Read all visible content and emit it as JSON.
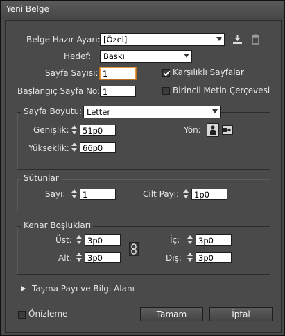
{
  "window": {
    "title": "Yeni Belge"
  },
  "preset": {
    "label": "Belge Hazır Ayarı:",
    "value": "[Özel]"
  },
  "intent": {
    "label": "Hedef:",
    "value": "Baskı"
  },
  "pages": {
    "label": "Sayfa Sayısı:",
    "value": "1"
  },
  "start_page": {
    "label": "Başlangıç Sayfa No:",
    "value": "1"
  },
  "facing_pages": {
    "label": "Karşılıklı Sayfalar",
    "checked": true
  },
  "primary_text_frame": {
    "label": "Birincil Metin Çerçevesi",
    "checked": false
  },
  "page_size": {
    "label": "Sayfa Boyutu:",
    "value": "Letter",
    "width_label": "Genişlik:",
    "width": "51p0",
    "height_label": "Yükseklik:",
    "height": "66p0",
    "orientation_label": "Yön:",
    "orientation_icons": [
      "portrait-icon",
      "landscape-icon"
    ]
  },
  "columns": {
    "title": "Sütunlar",
    "number_label": "Sayı:",
    "number": "1",
    "gutter_label": "Cilt Payı:",
    "gutter": "1p0"
  },
  "margins": {
    "title": "Kenar Boşlukları",
    "top_label": "Üst:",
    "top": "3p0",
    "bottom_label": "Alt:",
    "bottom": "3p0",
    "inside_label": "İç:",
    "inside": "3p0",
    "outside_label": "Dış:",
    "outside": "3p0",
    "link_icon": "chain-link-icon"
  },
  "bleed": {
    "label": "Taşma Payı ve Bilgi Alanı"
  },
  "preview": {
    "label": "Önizleme",
    "checked": false
  },
  "buttons": {
    "ok": "Tamam",
    "cancel": "İptal"
  }
}
